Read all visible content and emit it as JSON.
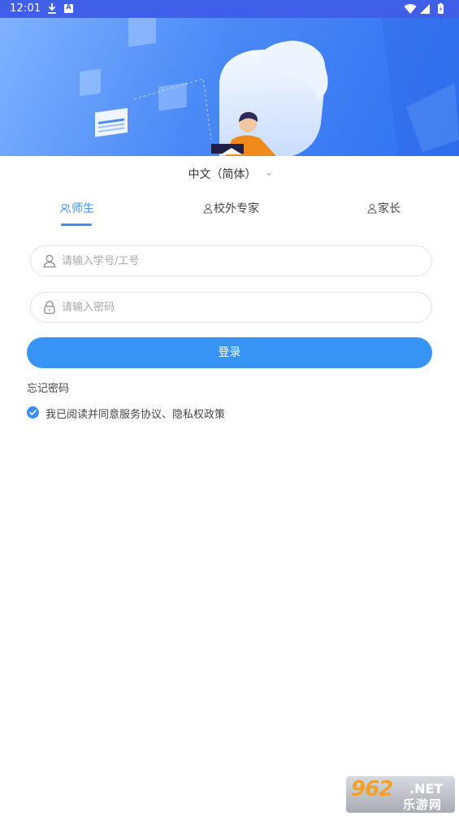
{
  "status_bar": {
    "time": "12:01",
    "badge": "A"
  },
  "language": {
    "label": "中文（简体）"
  },
  "tabs": [
    {
      "label": "师生",
      "icon": "users-icon",
      "active": true
    },
    {
      "label": "校外专家",
      "icon": "user-icon",
      "active": false
    },
    {
      "label": "家长",
      "icon": "user-icon",
      "active": false
    }
  ],
  "form": {
    "account_placeholder": "请输入学号/工号",
    "password_placeholder": "请输入密码",
    "login_label": "登录",
    "forgot_label": "忘记密码",
    "agreement_text": "我已阅读并同意服务协议、隐私权政策",
    "agreement_checked": true
  },
  "watermark": {
    "number": "962",
    "domain": ".NET",
    "name": "乐游网"
  },
  "colors": {
    "accent": "#3a8ef6",
    "status_bar": "#3f5fe9",
    "button": "#3894f4"
  }
}
